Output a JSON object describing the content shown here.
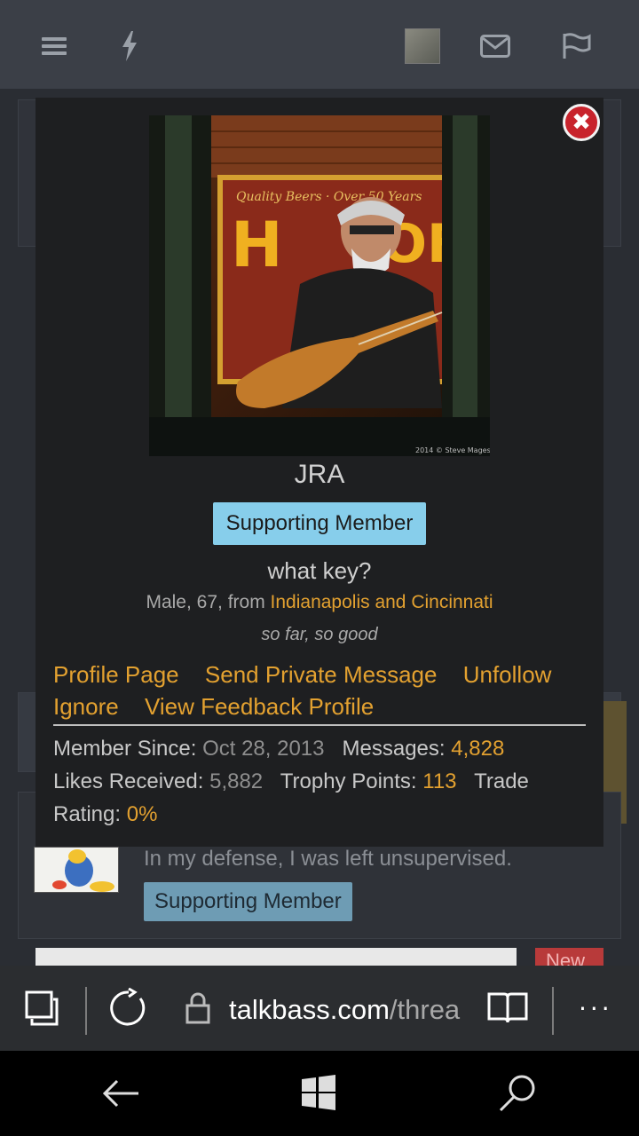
{
  "topbar": {
    "menu_icon": "hamburger-icon",
    "flash_icon": "lightning-icon",
    "avatar_icon": "user-avatar",
    "mail_icon": "envelope-icon",
    "alerts_icon": "flag-icon"
  },
  "background": {
    "signature": "In my defense, I was left unsupervised.",
    "badge": "Supporting Member",
    "button_partial": "New"
  },
  "popup": {
    "username": "JRA",
    "badge": "Supporting Member",
    "custom_title": "what key?",
    "info_prefix": "Male, 67,",
    "info_from": "from",
    "location": "Indianapolis and Cincinnati",
    "status": "so far, so good",
    "links": [
      "Profile Page",
      "Send Private Message",
      "Unfollow",
      "Ignore",
      "View Feedback Profile"
    ],
    "stats": {
      "member_since_label": "Member Since:",
      "member_since": "Oct 28, 2013",
      "messages_label": "Messages:",
      "messages": "4,828",
      "likes_label": "Likes Received:",
      "likes": "5,882",
      "trophy_label": "Trophy Points:",
      "trophy": "113",
      "trade_label": "Trade",
      "rating_label": "Rating:",
      "rating": "0%"
    },
    "photo_caption": "Quality Beers · Over 50 Years"
  },
  "browser": {
    "url_host": "talkbass.com",
    "url_path": "/threa"
  },
  "colors": {
    "accent": "#e3a130",
    "badge": "#87ceeb",
    "close": "#c8232c"
  }
}
